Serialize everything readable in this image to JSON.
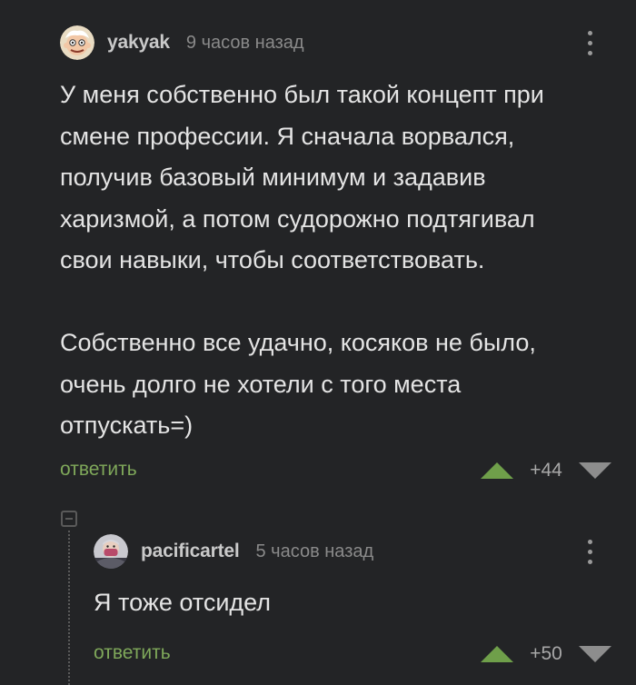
{
  "comments": [
    {
      "author": "yakyak",
      "time": "9 часов назад",
      "avatar_icon": "cartoon-face-avatar",
      "text": "У меня собственно был такой концепт при\nсмене профессии. Я сначала ворвался,\nполучив базовый минимум и задавив\nхаризмой, а потом судорожно подтягивал\nсвои навыки, чтобы соответствовать.\n\nСобственно все удачно, косяков не было,\nочень долго не хотели с того места\nотпускать=)",
      "reply_label": "ответить",
      "score": "+44"
    },
    {
      "author": "pacificartel",
      "time": "5 часов назад",
      "avatar_icon": "person-in-mask-avatar",
      "text": "Я тоже отсидел",
      "reply_label": "ответить",
      "score": "+50"
    }
  ],
  "colors": {
    "background": "#232426",
    "reply_link": "#7fa85a",
    "upvote": "#6f9f4a",
    "downvote": "#8d8d8d"
  }
}
